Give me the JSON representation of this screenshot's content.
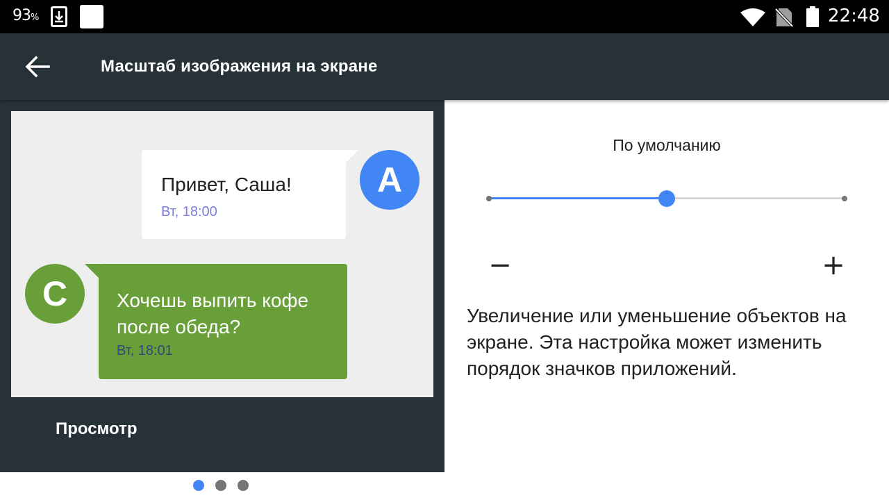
{
  "status_bar": {
    "battery_percent": "93",
    "battery_unit": "%",
    "time": "22:48",
    "icons": [
      "download-icon",
      "notification-square-icon",
      "wifi-icon",
      "no-sim-icon",
      "battery-icon"
    ]
  },
  "app_bar": {
    "back_icon": "arrow-back-icon",
    "title": "Масштаб изображения на экране"
  },
  "preview": {
    "incoming": {
      "avatar_letter": "A",
      "avatar_color": "#4285f4",
      "text": "Привет, Саша!",
      "time": "Вт, 18:00"
    },
    "outgoing": {
      "avatar_letter": "C",
      "avatar_color": "#689f38",
      "text": "Хочешь выпить кофе после обеда?",
      "time": "Вт, 18:01"
    },
    "label": "Просмотр"
  },
  "scale": {
    "current_label": "По умолчанию",
    "steps": 3,
    "current_step": 1,
    "minus_label": "−",
    "plus_label": "+",
    "accent_color": "#4285f4"
  },
  "description": "Увеличение или уменьшение объектов на экране. Эта настройка может изменить порядок значков приложений.",
  "pager": {
    "count": 3,
    "active": 0
  }
}
